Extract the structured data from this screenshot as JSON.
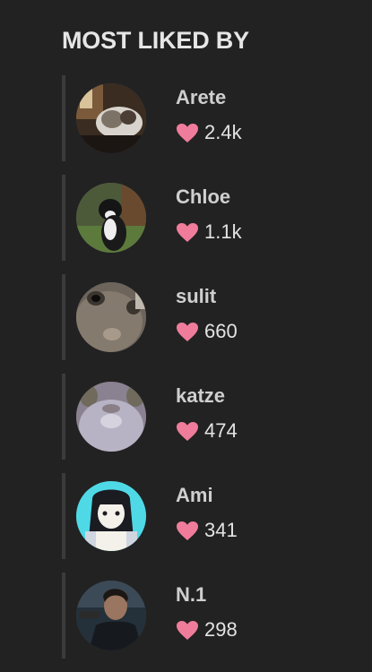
{
  "header": {
    "title": "MOST LIKED BY"
  },
  "colors": {
    "background": "#222222",
    "heart": "#f07c9b",
    "rule": "#3b3b3b"
  },
  "users": [
    {
      "name": "Arete",
      "likes": "2.4k",
      "avatar_icon": "cat-photo-avatar"
    },
    {
      "name": "Chloe",
      "likes": "1.1k",
      "avatar_icon": "cat-photo-avatar"
    },
    {
      "name": "sulit",
      "likes": "660",
      "avatar_icon": "cat-closeup-avatar"
    },
    {
      "name": "katze",
      "likes": "474",
      "avatar_icon": "cat-closeup-avatar"
    },
    {
      "name": "Ami",
      "likes": "341",
      "avatar_icon": "anime-girl-avatar"
    },
    {
      "name": "N.1",
      "likes": "298",
      "avatar_icon": "man-photo-avatar"
    }
  ]
}
